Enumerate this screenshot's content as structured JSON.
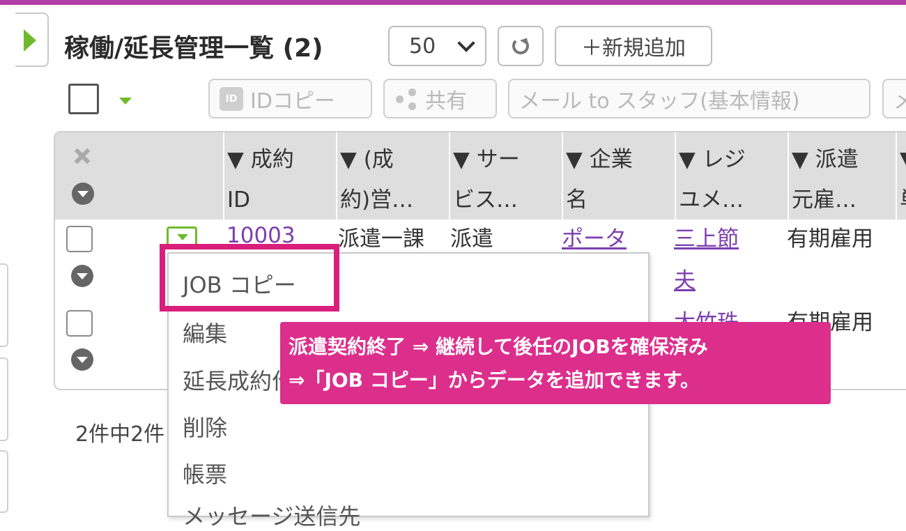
{
  "page": {
    "title": "稼働/延長管理一覧 (2)",
    "per_page": "50",
    "add_label": "＋新規追加",
    "summary": "2件中2件"
  },
  "colors": {
    "accent": "#6fba2c",
    "brand_bar": "#b43ea8",
    "annotation": "#d91e7c",
    "link": "#7c3fb0"
  },
  "icons": [
    "play-triangle-icon",
    "refresh-icon",
    "id-card-icon",
    "share-icon",
    "pin-off-icon",
    "chevron-down-icon"
  ],
  "toolbar": {
    "id_copy": "IDコピー",
    "id_icon_text": "ID",
    "share": "共有",
    "mail_staff": "メール to スタッフ(基本情報)",
    "more": "メ"
  },
  "table": {
    "headers": [
      "▼ 成約\nID",
      "▼ (成\n約)営…",
      "▼ サー\nビス…",
      "▼ 企業\n名",
      "▼ レジ\nユメ…",
      "▼ 派遣\n元雇…",
      "▼\n単"
    ],
    "rows": [
      [
        "10003",
        "派遣一課",
        "派遣",
        "ポータ",
        "三上節\n夫",
        "有期雇用"
      ],
      [
        "",
        "",
        "",
        "",
        "大竹珠\n希",
        "有期雇用"
      ]
    ]
  },
  "menu": {
    "items": [
      "JOB コピー",
      "編集",
      "延長成約作成",
      "削除",
      "帳票",
      "メッセージ送信先"
    ]
  },
  "annotation": {
    "line1": "派遣契約終了 ⇒ 継続して後任のJOBを確保済み",
    "line2": "⇒「JOB コピー」からデータを追加できます。"
  }
}
